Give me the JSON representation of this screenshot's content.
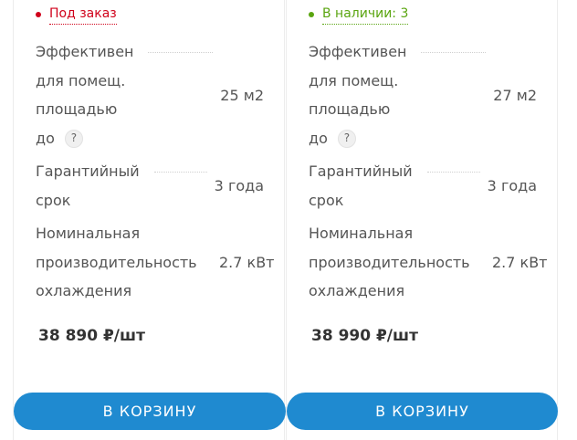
{
  "colors": {
    "accent": "#1f8ad0",
    "status_order": "#d0021b",
    "status_stock": "#5aa510"
  },
  "products": [
    {
      "status": "Под заказ",
      "props": {
        "area_name_lines": [
          "Эффективен",
          "для помещ.",
          "площадью",
          "до"
        ],
        "area_help": "?",
        "area_value": "25 м2",
        "warranty_name_lines": [
          "Гарантийный",
          "срок"
        ],
        "warranty_value": "3 года",
        "power_name_lines": [
          "Номинальная",
          "производительность",
          "охлаждения"
        ],
        "power_value": "2.7 кВт"
      },
      "price": "38 890 ₽/шт",
      "button": "В КОРЗИНУ"
    },
    {
      "status": "В наличии: 3",
      "props": {
        "area_name_lines": [
          "Эффективен",
          "для помещ.",
          "площадью",
          "до"
        ],
        "area_help": "?",
        "area_value": "27 м2",
        "warranty_name_lines": [
          "Гарантийный",
          "срок"
        ],
        "warranty_value": "3 года",
        "power_name_lines": [
          "Номинальная",
          "производительность",
          "охлаждения"
        ],
        "power_value": "2.7 кВт"
      },
      "price": "38 990 ₽/шт",
      "button": "В КОРЗИНУ"
    }
  ]
}
